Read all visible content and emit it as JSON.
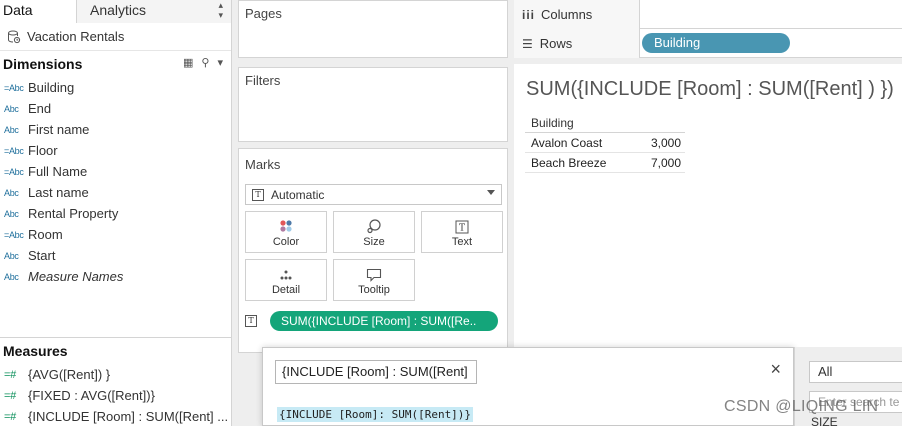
{
  "left_pane": {
    "tabs": {
      "data": "Data",
      "analytics": "Analytics"
    },
    "data_source": "Vacation Rentals",
    "dimensions_header": "Dimensions",
    "dimensions": [
      {
        "type": "=Abc",
        "name": "Building",
        "italic": false
      },
      {
        "type": "Abc",
        "name": "End",
        "italic": false
      },
      {
        "type": "Abc",
        "name": "First name",
        "italic": false
      },
      {
        "type": "=Abc",
        "name": "Floor",
        "italic": false
      },
      {
        "type": "=Abc",
        "name": "Full Name",
        "italic": false
      },
      {
        "type": "Abc",
        "name": "Last name",
        "italic": false
      },
      {
        "type": "Abc",
        "name": "Rental Property",
        "italic": false
      },
      {
        "type": "=Abc",
        "name": "Room",
        "italic": false
      },
      {
        "type": "Abc",
        "name": "Start",
        "italic": false
      },
      {
        "type": "Abc",
        "name": "Measure Names",
        "italic": true
      }
    ],
    "measures_header": "Measures",
    "measures": [
      {
        "type": "=#",
        "name": "{AVG([Rent]) }"
      },
      {
        "type": "=#",
        "name": "{FIXED : AVG([Rent])}"
      },
      {
        "type": "=#",
        "name": "{INCLUDE [Room] : SUM([Rent] ..."
      }
    ]
  },
  "shelves": {
    "pages": "Pages",
    "filters": "Filters",
    "marks": "Marks",
    "mark_type": "Automatic",
    "mark_type_icon": "T",
    "buttons": {
      "color": "Color",
      "size": "Size",
      "text": "Text",
      "detail": "Detail",
      "tooltip": "Tooltip"
    },
    "mark_pill": "SUM({INCLUDE [Room] : SUM([Re..",
    "columns_label": "Columns",
    "rows_label": "Rows",
    "rows_pill": "Building"
  },
  "view": {
    "title": "SUM({INCLUDE [Room] : SUM([Rent] ) })",
    "header": "Building",
    "rows": [
      {
        "building": "Avalon Coast",
        "value": "3,000"
      },
      {
        "building": "Beach Breeze",
        "value": "7,000"
      }
    ]
  },
  "calc_editor": {
    "name_value": "{INCLUDE [Room] : SUM([Rent]",
    "formula": "{INCLUDE [Room]: SUM([Rent])}",
    "close_icon": "×"
  },
  "functions_panel": {
    "category": "All",
    "search_placeholder": "Enter search te",
    "first_item": "SIZE"
  },
  "watermark": "CSDN @LIQING LIN"
}
